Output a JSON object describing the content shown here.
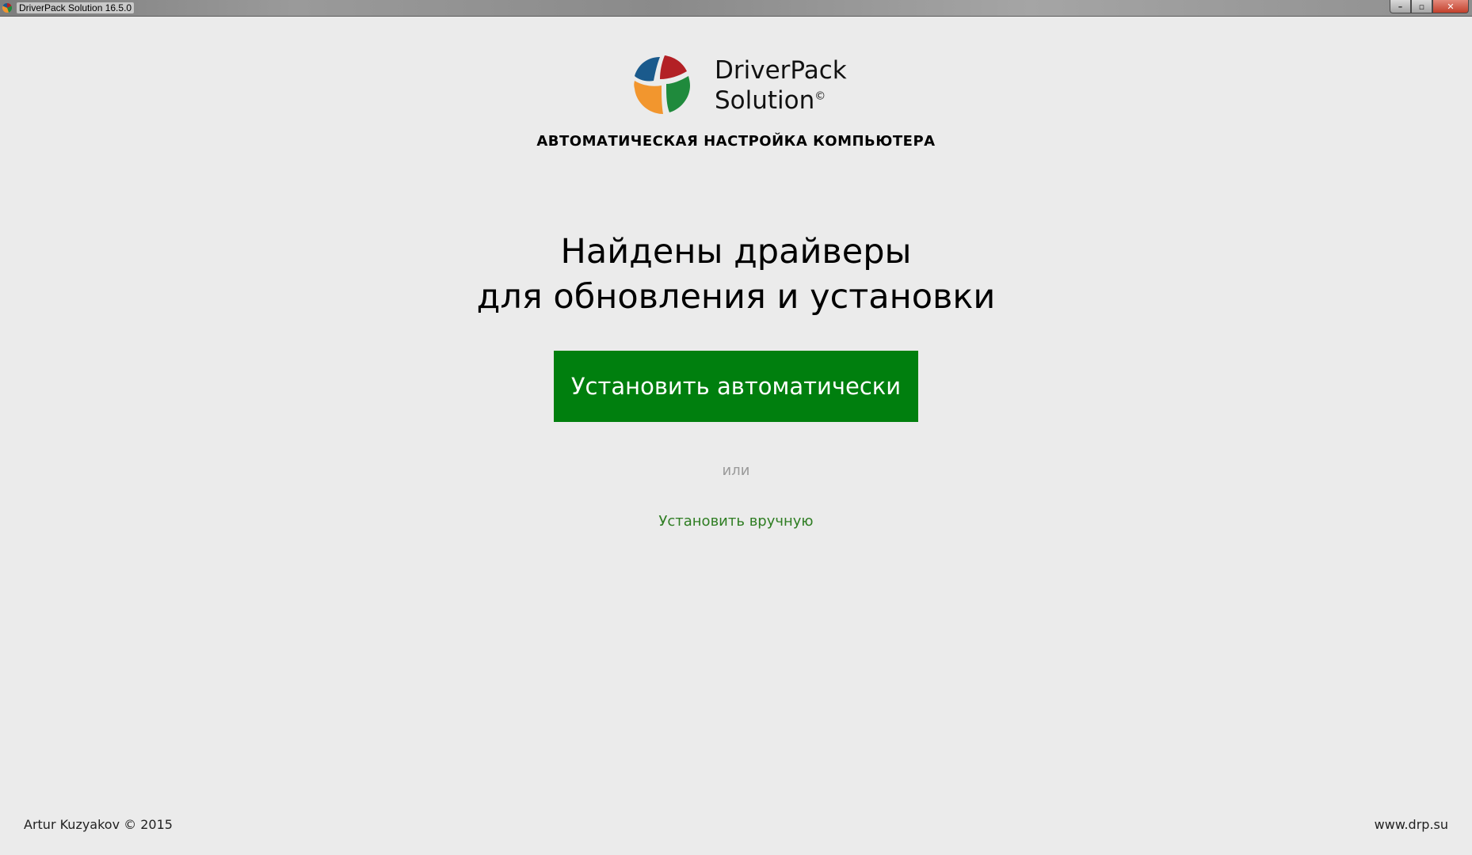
{
  "window": {
    "title": "DriverPack Solution 16.5.0",
    "controls": {
      "minimize": "–",
      "maximize": "▫",
      "close": "✕"
    }
  },
  "logo": {
    "line1": "DriverPack",
    "line2": "Solution",
    "copyright_mark": "©",
    "colors": {
      "blue": "#1a5a8c",
      "red": "#b32025",
      "green": "#1f8a3c",
      "orange": "#f2962e"
    }
  },
  "subtitle": "АВТОМАТИЧЕСКАЯ НАСТРОЙКА КОМПЬЮТЕРА",
  "headline": {
    "line1": "Найдены драйверы",
    "line2": "для обновления и установки"
  },
  "actions": {
    "install_auto_label": "Установить автоматически",
    "or_label": "или",
    "install_manual_label": "Установить вручную"
  },
  "footer": {
    "author": "Artur Kuzyakov © 2015",
    "website": "www.drp.su"
  },
  "colors": {
    "background": "#ebebeb",
    "primary_button": "#007f0e",
    "link": "#2e7d22",
    "muted_text": "#9a9a9a"
  }
}
